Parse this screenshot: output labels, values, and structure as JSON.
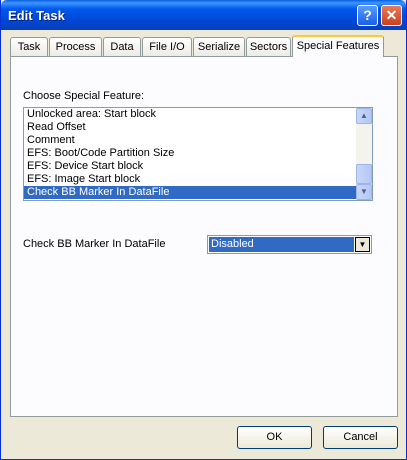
{
  "window": {
    "title": "Edit Task",
    "help_glyph": "?",
    "close_glyph": "✕"
  },
  "tabs": [
    {
      "label": "Task"
    },
    {
      "label": "Process"
    },
    {
      "label": "Data"
    },
    {
      "label": "File I/O"
    },
    {
      "label": "Serialize"
    },
    {
      "label": "Sectors"
    },
    {
      "label": "Special Features",
      "active": true
    }
  ],
  "feature_list": {
    "label": "Choose Special Feature:",
    "items": [
      "Unlocked area: Start block",
      "Read Offset",
      "Comment",
      "EFS: Boot/Code Partition Size",
      "EFS: Device Start block",
      "EFS: Image Start block",
      "Check BB Marker In DataFile"
    ],
    "selected_index": 6
  },
  "setting": {
    "label": "Check BB Marker In DataFile",
    "value": "Disabled"
  },
  "buttons": {
    "ok": "OK",
    "cancel": "Cancel"
  },
  "icons": {
    "scroll_up": "scroll-up-arrow-icon",
    "scroll_down": "scroll-down-arrow-icon",
    "dropdown": "dropdown-arrow-icon"
  }
}
